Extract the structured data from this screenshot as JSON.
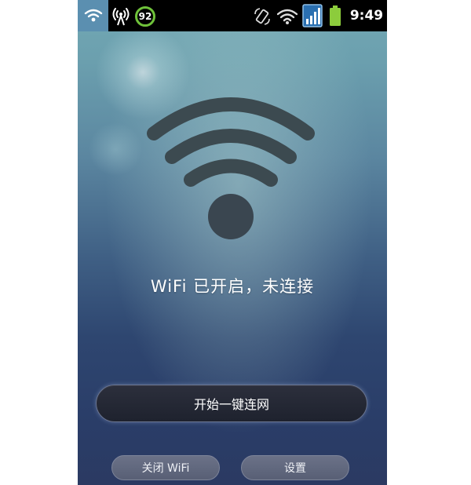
{
  "status_bar": {
    "badge_value": "92",
    "time": "9:49",
    "icons": [
      "wifi-icon",
      "tethering-icon",
      "auto-rotate-icon",
      "wifi-signal-icon",
      "cell-signal-icon",
      "battery-icon"
    ],
    "colors": {
      "bar": "#000000",
      "battery": "#8ccc3c",
      "badge_ring": "#6fc23a",
      "wifi_highlight": "#5b8fb0"
    }
  },
  "main": {
    "hero_icon": "wifi-icon",
    "status_message": "WiFi 已开启，未连接",
    "connect_label": "开始一键连网",
    "turn_off_label": "关闭 WiFi",
    "settings_label": "设置"
  },
  "colors": {
    "background_top": "#73a9b4",
    "background_bottom": "#2b3a62",
    "primary_button": "#24283a",
    "secondary_button": "#626980"
  }
}
